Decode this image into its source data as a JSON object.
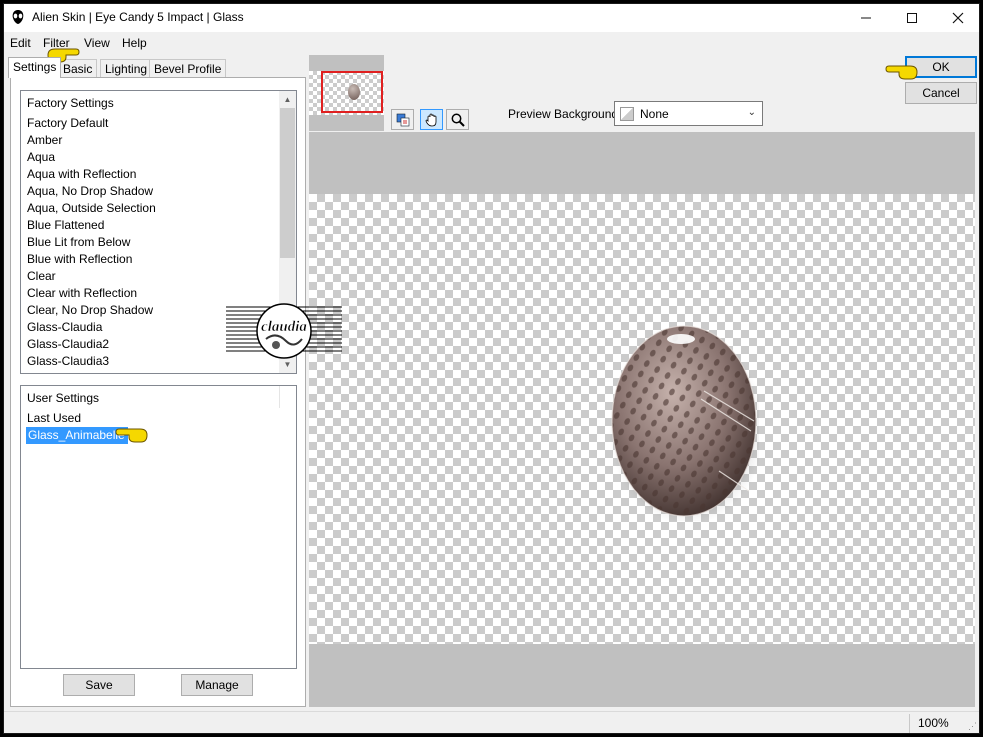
{
  "window": {
    "title": "Alien Skin | Eye Candy 5 Impact | Glass"
  },
  "menu": [
    "Edit",
    "Filter",
    "View",
    "Help"
  ],
  "tabs": [
    "Settings",
    "Basic",
    "Lighting",
    "Bevel Profile"
  ],
  "factory_settings": {
    "header": "Factory Settings",
    "items": [
      "Factory Default",
      "Amber",
      "Aqua",
      "Aqua with Reflection",
      "Aqua, No Drop Shadow",
      "Aqua, Outside Selection",
      "Blue Flattened",
      "Blue Lit from Below",
      "Blue with Reflection",
      "Clear",
      "Clear with Reflection",
      "Clear, No Drop Shadow",
      "Glass-Claudia",
      "Glass-Claudia2",
      "Glass-Claudia3"
    ]
  },
  "user_settings": {
    "header": "User Settings",
    "items": [
      "Last Used",
      "Glass_Animabelle"
    ],
    "selected": "Glass_Animabelle"
  },
  "buttons": {
    "save": "Save",
    "manage": "Manage",
    "ok": "OK",
    "cancel": "Cancel"
  },
  "preview_background": {
    "label": "Preview Background:",
    "value": "None"
  },
  "status": {
    "zoom": "100%"
  },
  "watermark": {
    "text": "claudia"
  },
  "colors": {
    "selection": "#3399ff",
    "pointer": "#f5d800",
    "nav_frame": "#e02020",
    "ok_border": "#0078d7"
  }
}
